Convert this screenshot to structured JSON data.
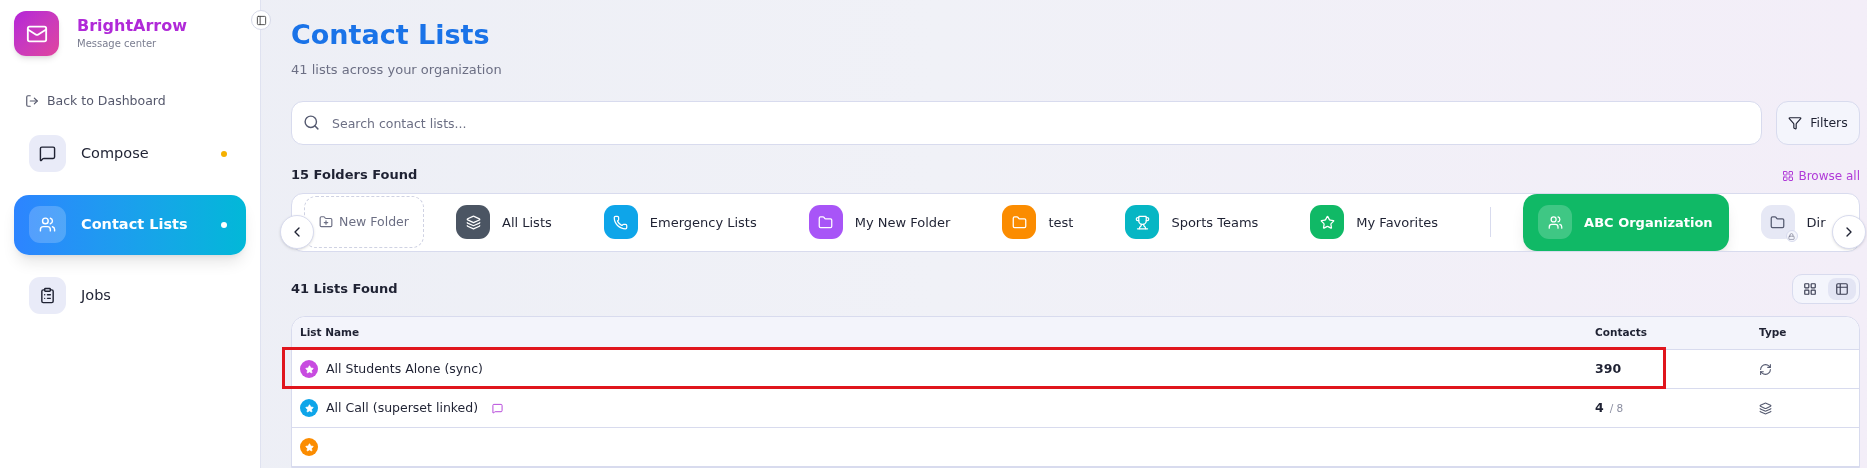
{
  "sidebar": {
    "brand": {
      "name": "BrightArrow",
      "subtitle": "Message center"
    },
    "back_link": "Back to Dashboard",
    "items": [
      {
        "label": "Compose",
        "selected": false,
        "color": "#f5b000"
      },
      {
        "label": "Contact Lists",
        "selected": true,
        "color": "#ffffff"
      },
      {
        "label": "Jobs",
        "selected": false
      }
    ]
  },
  "header": {
    "title": "Contact Lists",
    "subtitle": "41 lists across your organization"
  },
  "search": {
    "placeholder": "Search contact lists..."
  },
  "filters_button": "Filters",
  "folders": {
    "heading": "15 Folders Found",
    "browse_all": "Browse all",
    "items": [
      {
        "kind": "new",
        "label": "New Folder",
        "selected": false
      },
      {
        "kind": "folder",
        "label": "All Lists",
        "color": "#4b5563",
        "selected": false
      },
      {
        "kind": "folder",
        "label": "Emergency Lists",
        "color": "#0ea5e9",
        "selected": false
      },
      {
        "kind": "folder",
        "label": "My New Folder",
        "color": "#a855f7",
        "selected": false
      },
      {
        "kind": "folder",
        "label": "test",
        "color": "#fb8c00",
        "selected": false
      },
      {
        "kind": "folder",
        "label": "Sports Teams",
        "color": "#06b6c4",
        "selected": false
      },
      {
        "kind": "folder",
        "label": "My Favorites",
        "color": "#10b966",
        "selected": false
      },
      {
        "kind": "divider"
      },
      {
        "kind": "folder",
        "label": "ABC Organization",
        "color": "#10b966",
        "selected": true
      },
      {
        "kind": "locked",
        "label": "Dir",
        "color": "#e6e8f5",
        "selected": false
      }
    ]
  },
  "lists": {
    "heading": "41 Lists Found",
    "view_modes": [
      {
        "selected": false
      },
      {
        "selected": true
      }
    ],
    "table": {
      "columns": [
        "List Name",
        "Contacts",
        "Type"
      ],
      "rows": [
        {
          "name": "All Students Alone (sync)",
          "color": "#c84be0",
          "contacts": "390",
          "kind": "sync",
          "has_note": false,
          "highlighted": true
        },
        {
          "name": "All Call (superset linked)",
          "color": "#0ea5e9",
          "contacts": "4",
          "contacts_total": "/ 8",
          "kind": "superset",
          "has_note": true,
          "highlighted": false
        },
        {
          "color": "#fb8c00",
          "highlighted": false
        }
      ]
    }
  }
}
